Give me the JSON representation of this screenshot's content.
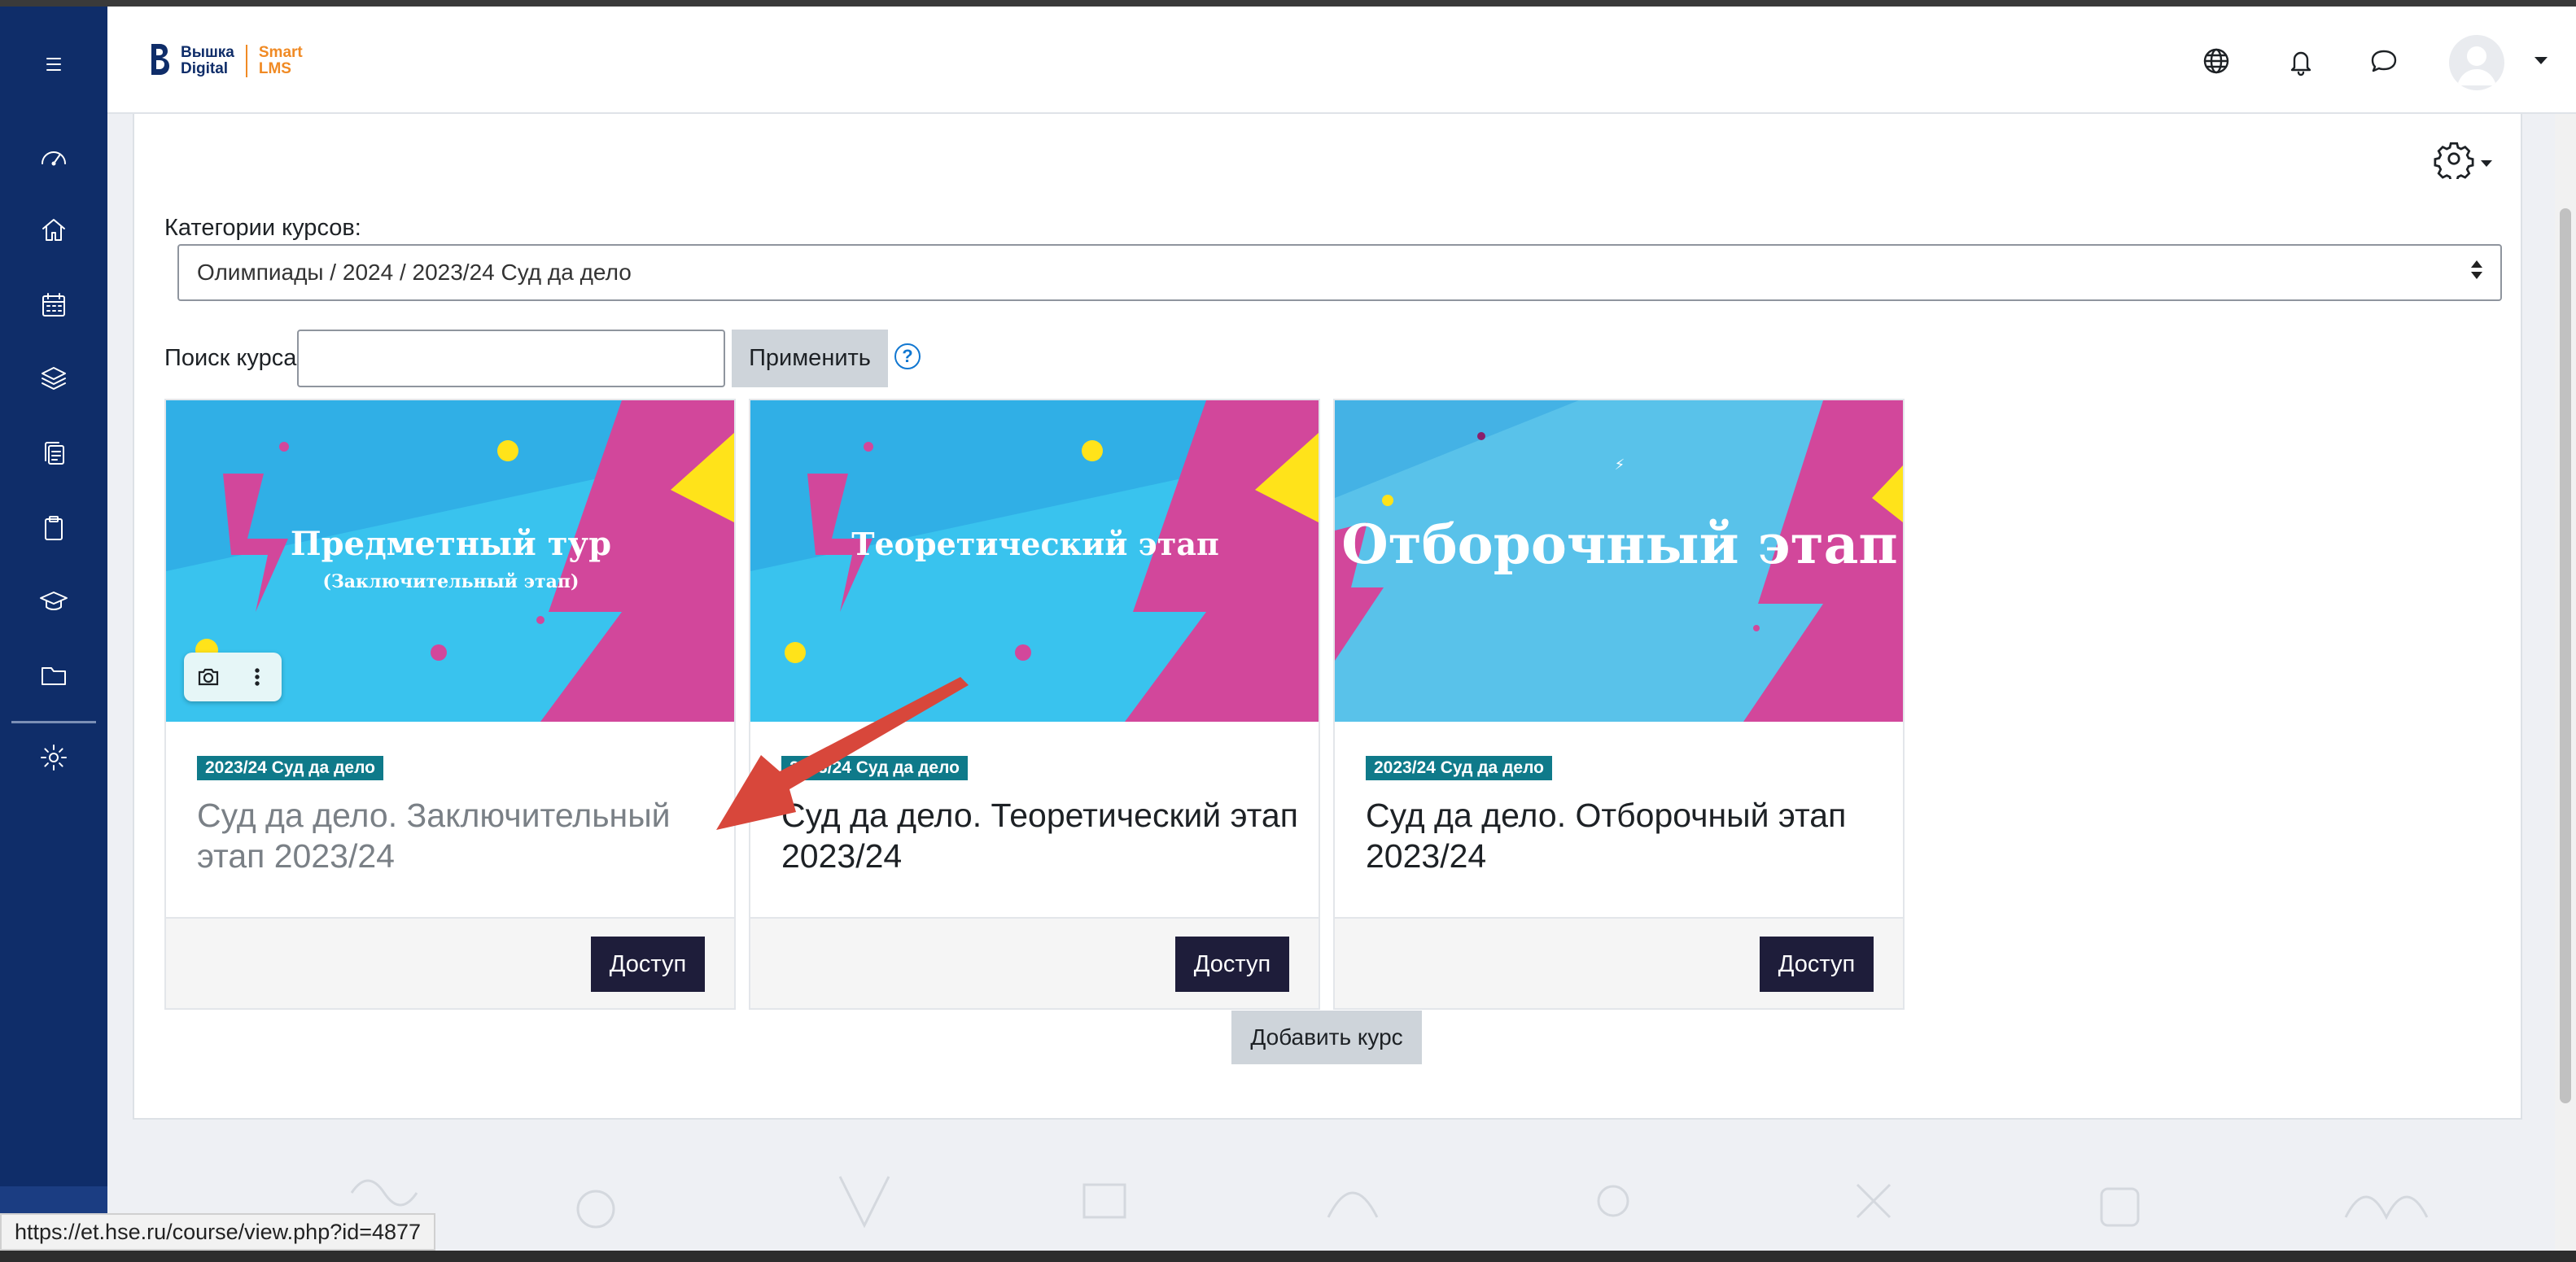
{
  "app": {
    "logo_line1": "Вышка",
    "logo_line2": "Digital",
    "logo_smart": "Smart",
    "logo_lms": "LMS"
  },
  "sidebar": {
    "items": [
      {
        "icon": "menu-icon"
      },
      {
        "icon": "dashboard-icon"
      },
      {
        "icon": "home-icon"
      },
      {
        "icon": "calendar-icon"
      },
      {
        "icon": "layers-icon"
      },
      {
        "icon": "copy-icon"
      },
      {
        "icon": "clipboard-icon"
      },
      {
        "icon": "graduation-cap-icon"
      },
      {
        "icon": "folder-icon"
      },
      {
        "icon": "gear-icon"
      }
    ]
  },
  "topbar": {
    "icons": [
      "globe-icon",
      "bell-icon",
      "chat-icon"
    ]
  },
  "filters": {
    "category_label": "Категории курсов:",
    "category_value": "Олимпиады / 2024 / 2023/24 Суд да дело",
    "search_label": "Поиск курса",
    "search_value": "",
    "apply_label": "Применить",
    "help": "?"
  },
  "courses": [
    {
      "image_title": "Предметный тур",
      "image_subtitle": "(Заключительный этап)",
      "category": "2023/24 Суд да дело",
      "title": "Суд да дело. Заключительный этап 2023/24",
      "access": "Доступ"
    },
    {
      "image_title": "Теоретический этап",
      "image_subtitle": "",
      "category": "2023/24 Суд да дело",
      "title": "Суд да дело. Теоретический этап 2023/24",
      "access": "Доступ"
    },
    {
      "image_title": "Отборочный этап",
      "image_subtitle": "",
      "category": "2023/24 Суд да дело",
      "title": "Суд да дело. Отборочный этап 2023/24",
      "access": "Доступ"
    }
  ],
  "add_course_label": "Добавить курс",
  "status_url": "https://et.hse.ru/course/view.php?id=4877",
  "colors": {
    "sidebar": "#0f2d69",
    "badge": "#0f7a8a",
    "access_button": "#1e1d3a",
    "banner_blue": "#39c3ee",
    "banner_pink": "#d2479b",
    "banner_yellow": "#ffe31a"
  }
}
